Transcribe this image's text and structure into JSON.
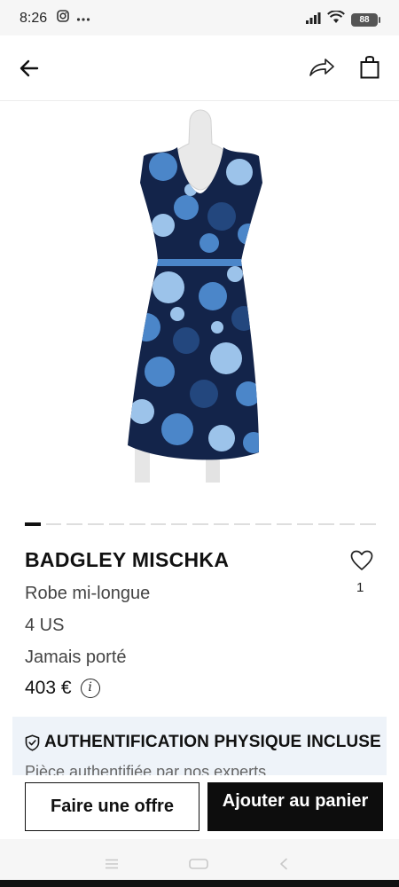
{
  "status_bar": {
    "time": "8:26",
    "battery": "88",
    "icons": [
      "instagram-icon",
      "more-dots-icon",
      "signal-icon",
      "wifi-icon",
      "battery-icon"
    ]
  },
  "header": {
    "icons": [
      "back-arrow-icon",
      "share-icon",
      "shopping-bag-icon"
    ]
  },
  "carousel": {
    "total": 17,
    "active_index": 0
  },
  "product": {
    "brand": "BADGLEY MISCHKA",
    "category": "Robe mi-longue",
    "size": "4 US",
    "condition": "Jamais porté",
    "price": "403 €",
    "likes": "1",
    "colors": {
      "dress_navy": "#13244a",
      "dress_blue": "#4b86c9",
      "dress_light": "#9cc3ea"
    }
  },
  "auth_banner": {
    "title": "AUTHENTIFICATION PHYSIQUE INCLUSE",
    "subtitle": "Pièce authentifiée par nos experts",
    "background": "#eef3f9"
  },
  "actions": {
    "offer_label": "Faire une offre",
    "cart_label": "Ajouter au panier"
  },
  "system_nav": {
    "icons": [
      "menu-icon",
      "home-icon",
      "back-icon"
    ]
  }
}
